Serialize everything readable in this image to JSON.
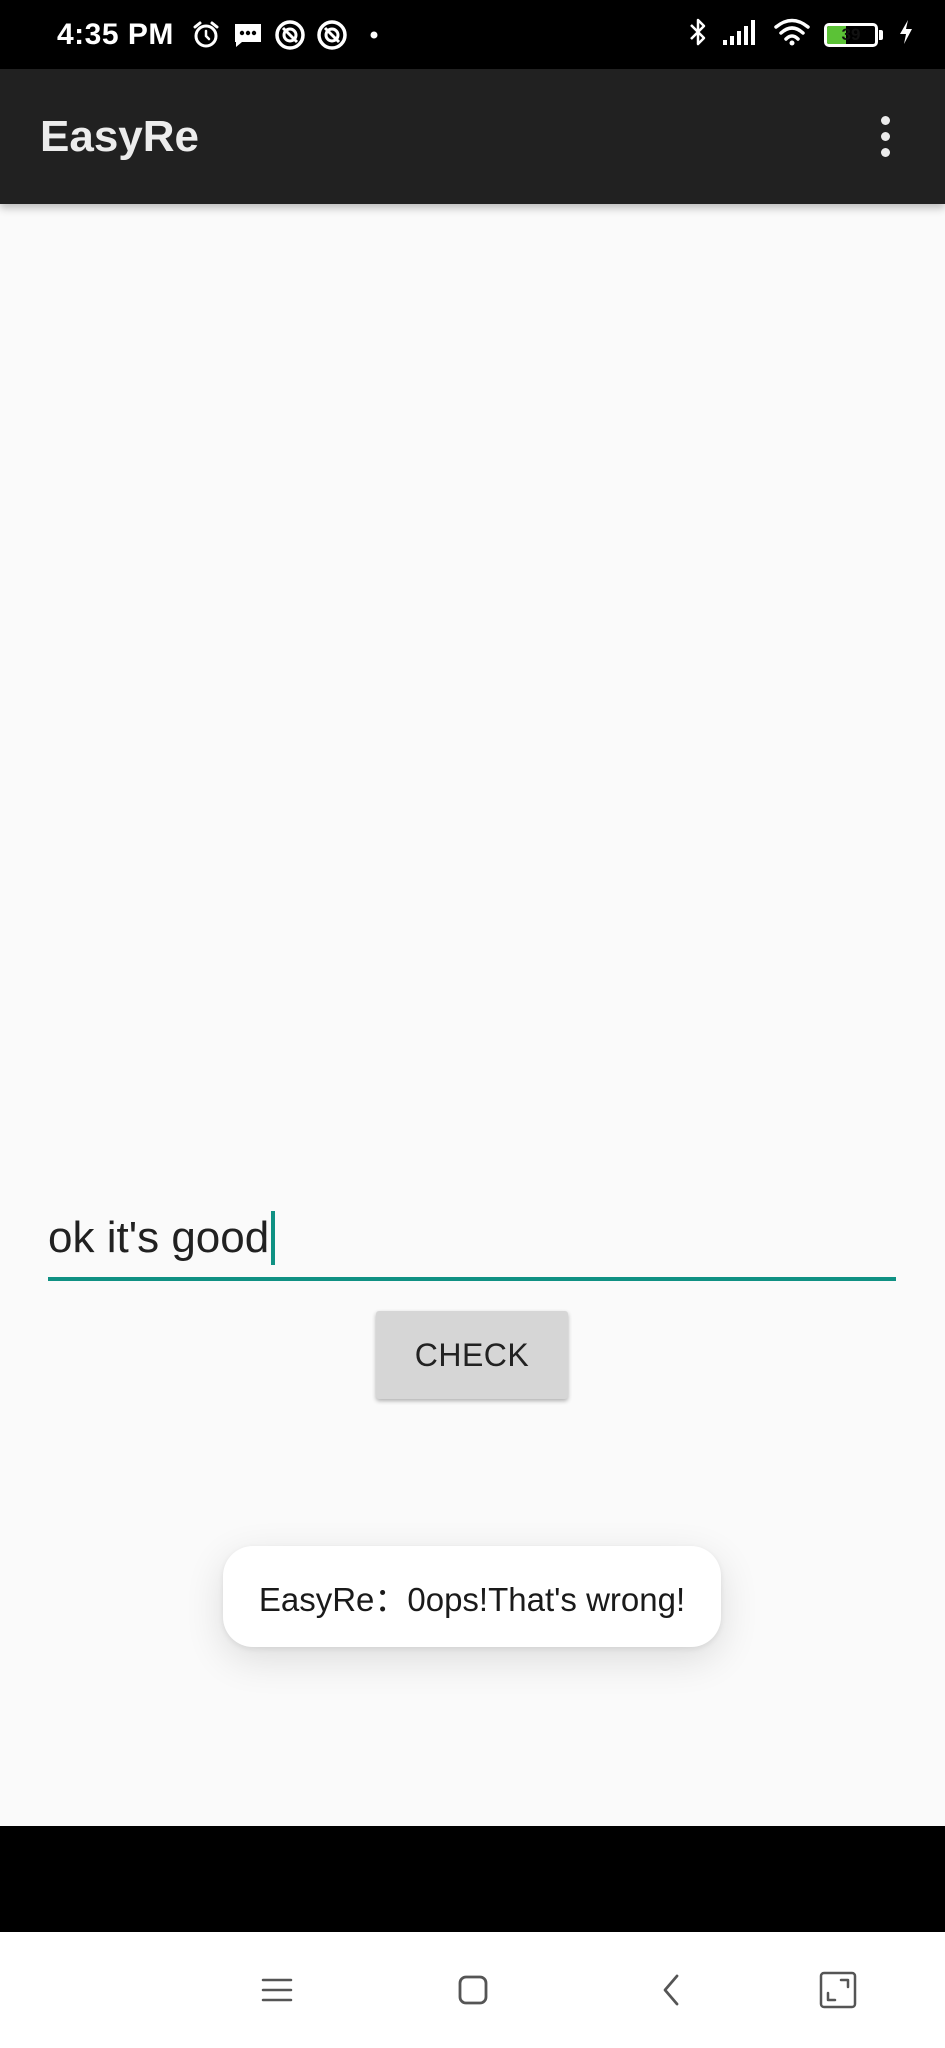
{
  "status_bar": {
    "time": "4:35 PM",
    "battery_level": "39",
    "battery_fraction": 0.39,
    "left_icons": [
      "alarm-icon",
      "message-icon",
      "app-notification-icon",
      "app-notification-icon",
      "dot-icon"
    ],
    "right_icons": [
      "bluetooth-icon",
      "signal-icon",
      "wifi-icon",
      "battery-icon",
      "charging-icon"
    ]
  },
  "app_bar": {
    "title": "EasyRe",
    "menu_icon": "overflow-menu-icon"
  },
  "form": {
    "input_value": "ok it's good",
    "check_label": "CHECK"
  },
  "toast": {
    "message": "EasyRe：0ops!That's wrong!"
  },
  "nav_bar": {
    "icons": [
      "menu-icon",
      "home-icon",
      "back-icon",
      "screenshot-icon"
    ]
  },
  "colors": {
    "accent": "#0f9183",
    "app_bar": "#212121",
    "background": "#fafafa",
    "button": "#d6d6d6",
    "battery": "#5bc236"
  }
}
